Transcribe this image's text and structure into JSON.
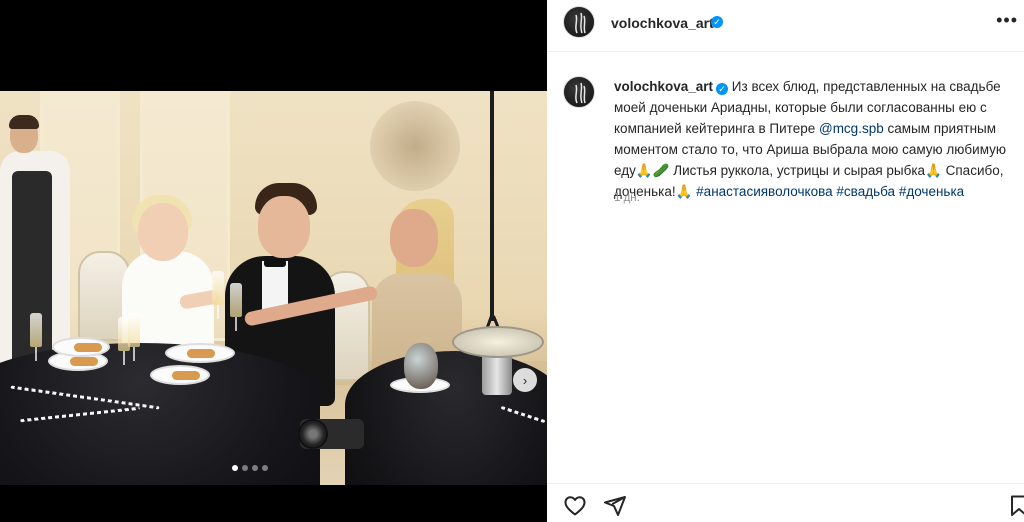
{
  "post": {
    "username": "volochkova_art",
    "verified_icon": "verified-badge-icon",
    "more_icon": "more-options-icon",
    "caption": {
      "username": "volochkova_art",
      "text_part1": " Из всех блюд, представленных на свадьбе моей доченьки Ариадны, которые были согласованны ею с компанией кейтеринга в Питере ",
      "mention": "@mcg.spb",
      "text_part2": " самым приятным моментом стало то, что Ариша выбрала мою самую любимую еду",
      "emoji1": "🙏🥒",
      "text_part3": " Листья руккола, устрицы и сырая рыбка",
      "emoji2": "🙏",
      "text_part4": " Спасибо, доченька!",
      "emoji3": "🙏",
      "hashtags": [
        "#анастасияволочкова",
        "#свадьба",
        "#доченька"
      ]
    },
    "timestamp": "1 дн."
  },
  "carousel": {
    "next_icon": "chevron-right-icon",
    "next_label": "›",
    "slide_count": 4,
    "active_slide": 1
  },
  "actions": {
    "like_icon": "heart-icon",
    "share_icon": "send-icon",
    "save_icon": "bookmark-icon"
  }
}
